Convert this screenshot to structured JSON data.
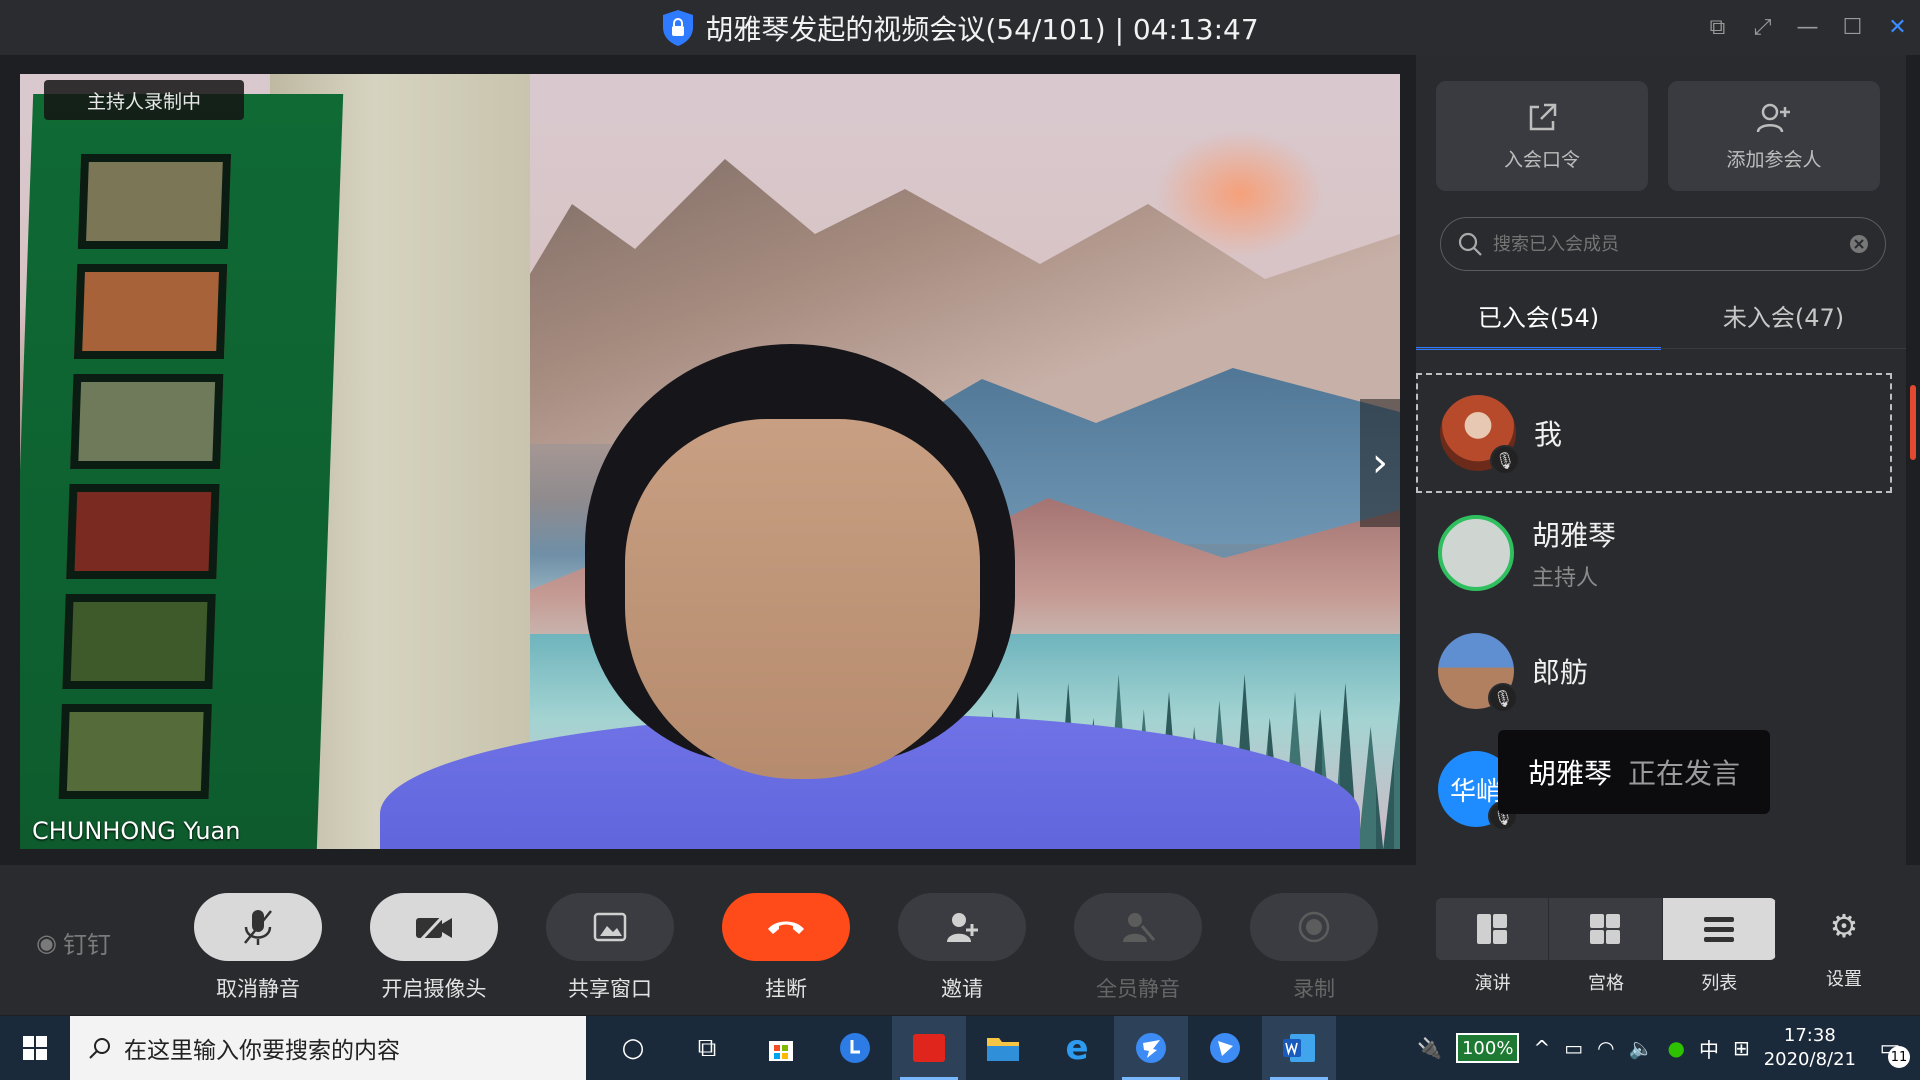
{
  "window": {
    "title": "胡雅琴发起的视频会议(54/101) | 04:13:47",
    "controls": [
      "restore-layout-icon",
      "fullscreen-icon",
      "minimize-icon",
      "maximize-icon",
      "close-icon"
    ]
  },
  "video": {
    "recording_badge": "主持人录制中",
    "speaker_name": "CHUNHONG Yuan"
  },
  "panel": {
    "quick_actions": [
      {
        "label": "入会口令",
        "icon": "share-link-icon"
      },
      {
        "label": "添加参会人",
        "icon": "add-person-icon"
      }
    ],
    "search": {
      "placeholder": "搜索已入会成员"
    },
    "tabs": [
      {
        "label": "已入会(54)",
        "active": true
      },
      {
        "label": "未入会(47)",
        "active": false
      }
    ],
    "members": [
      {
        "name": "我",
        "role": "",
        "muted": true
      },
      {
        "name": "胡雅琴",
        "role": "主持人",
        "muted": false
      },
      {
        "name": "郎舫",
        "role": "",
        "muted": true
      },
      {
        "name": "华峭",
        "role": "",
        "muted": true,
        "avatar_text": "华峭"
      }
    ],
    "speaking_toast": {
      "name": "胡雅琴",
      "state": "正在发言"
    }
  },
  "toolbar": {
    "logo": "钉钉",
    "buttons": [
      {
        "label": "取消静音",
        "icon": "mic-muted-icon",
        "style": "light"
      },
      {
        "label": "开启摄像头",
        "icon": "camera-off-icon",
        "style": "light"
      },
      {
        "label": "共享窗口",
        "icon": "share-screen-icon",
        "style": "dark"
      },
      {
        "label": "挂断",
        "icon": "hang-up-icon",
        "style": "red"
      },
      {
        "label": "邀请",
        "icon": "invite-icon",
        "style": "dark"
      },
      {
        "label": "全员静音",
        "icon": "mute-all-icon",
        "style": "disabled"
      },
      {
        "label": "录制",
        "icon": "record-icon",
        "style": "disabled"
      }
    ],
    "views": [
      {
        "label": "演讲",
        "active": false
      },
      {
        "label": "宫格",
        "active": false
      },
      {
        "label": "列表",
        "active": true
      }
    ],
    "settings_label": "设置"
  },
  "taskbar": {
    "search_placeholder": "在这里输入你要搜索的内容",
    "apps": [
      "cortana-icon",
      "task-view-icon",
      "store-icon",
      "clock-app-icon",
      "youdao-icon",
      "file-explorer-icon",
      "edge-icon",
      "dingtalk-icon",
      "feishu-icon",
      "word-icon"
    ],
    "battery": "100%",
    "ime": "中",
    "time": "17:38",
    "date": "2020/8/21",
    "notifications": "11"
  },
  "colors": {
    "accent": "#2f7bff",
    "hangup": "#ff4a1a",
    "panel_bg": "#2a2b2f"
  }
}
